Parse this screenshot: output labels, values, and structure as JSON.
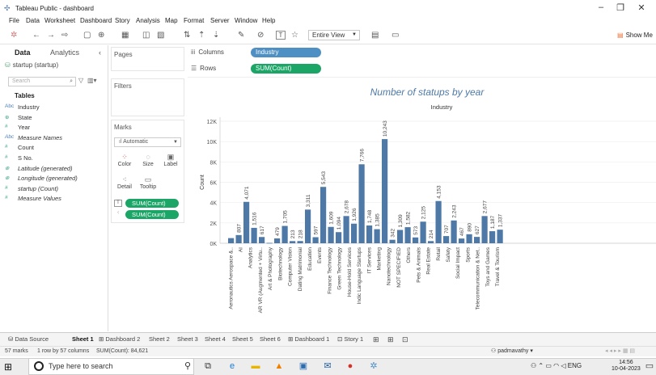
{
  "window": {
    "title": "Tableau Public - dashboard"
  },
  "menu": [
    "File",
    "Data",
    "Worksheet",
    "Dashboard",
    "Story",
    "Analysis",
    "Map",
    "Format",
    "Server",
    "Window",
    "Help"
  ],
  "toolbar": {
    "fit": "Entire View",
    "show_me": "Show Me"
  },
  "left_pane": {
    "tabs": [
      "Data",
      "Analytics"
    ],
    "datasource": "startup (startup)",
    "search_placeholder": "Search",
    "tables_header": "Tables",
    "fields": [
      {
        "label": "Industry",
        "type": "Abc"
      },
      {
        "label": "State",
        "type": "geo"
      },
      {
        "label": "Year",
        "type": "#"
      },
      {
        "label": "Measure Names",
        "type": "Abc"
      },
      {
        "label": "Count",
        "type": "#"
      },
      {
        "label": "S No.",
        "type": "#"
      },
      {
        "label": "Latitude (generated)",
        "type": "geo"
      },
      {
        "label": "Longitude (generated)",
        "type": "geo"
      },
      {
        "label": "startup (Count)",
        "type": "#"
      },
      {
        "label": "Measure Values",
        "type": "#"
      }
    ]
  },
  "cards": {
    "pages": "Pages",
    "filters": "Filters",
    "marks": "Marks",
    "mark_type": "Automatic",
    "mark_buttons": [
      "Color",
      "Size",
      "Label",
      "Detail",
      "Tooltip"
    ],
    "mark_pills": [
      "SUM(Count)",
      "SUM(Count)"
    ]
  },
  "shelves": {
    "columns_label": "Columns",
    "rows_label": "Rows",
    "columns_pill": "Industry",
    "rows_pill": "SUM(Count)"
  },
  "colors": {
    "pill_blue": "#4e8fc4",
    "pill_green": "#1ba667",
    "bar": "#4e79a7",
    "title": "#4e79a7"
  },
  "chart_data": {
    "type": "bar",
    "title": "Number of statups by year",
    "header": "Industry",
    "ylabel": "Count",
    "ylim": [
      0,
      12000
    ],
    "yticks": [
      "0K",
      "2K",
      "4K",
      "6K",
      "8K",
      "10K",
      "12K"
    ],
    "categories": [
      "Aeronautics Aerospace &..",
      "AI",
      "Analytics",
      "AR VR (Augmented + Virtu..",
      "Art & Photography",
      "Biotechnology",
      "Computer Vision",
      "Dating Matrimonial",
      "Education",
      "Events",
      "Finance Technology",
      "Green Technology",
      "House-Hold Services",
      "Indic Language Startups",
      "IT Services",
      "Marketing",
      "Nanotechnology",
      "NOT SPECIFIED",
      "Others",
      "Pets & Animals",
      "Real Estate",
      "Retail",
      "Safety",
      "Social Impact",
      "Sports",
      "Telecommunication & Net..",
      "Toys and Games",
      "Travel & Tourism"
    ],
    "values": [
      507,
      807,
      4071,
      1516,
      617,
      38,
      479,
      1705,
      213,
      218,
      3311,
      597,
      5543,
      1609,
      1094,
      2678,
      1926,
      7766,
      1748,
      1385,
      10243,
      342,
      1309,
      1582,
      573,
      2125,
      214,
      4153,
      707,
      2243,
      467,
      890,
      627,
      2677,
      1187,
      1337
    ],
    "labels": [
      "",
      "807",
      "4,071",
      "1,516",
      "617",
      "",
      "479",
      "1,705",
      "213",
      "218",
      "3,311",
      "597",
      "5,543",
      "1,609",
      "1,094",
      "2,678",
      "1,926",
      "7,766",
      "1,748",
      "1,385",
      "10,243",
      "342",
      "1,309",
      "1,582",
      "573",
      "2,125",
      "214",
      "4,153",
      "707",
      "2,243",
      "467",
      "890",
      "627",
      "2,677",
      "1,187",
      "1,337"
    ]
  },
  "sheet_tabs": [
    "Data Source",
    "Sheet 1",
    "Dashboard 2",
    "Sheet 2",
    "Sheet 3",
    "Sheet 4",
    "Sheet 5",
    "Sheet 6",
    "Dashboard 1",
    "Story 1"
  ],
  "status": {
    "marks": "57 marks",
    "rows": "1 row by 57 columns",
    "sum": "SUM(Count): 84,621",
    "user": "padmavathy"
  },
  "taskbar": {
    "search": "Type here to search",
    "lang": "ENG",
    "time": "14:56",
    "date": "10-04-2023"
  }
}
